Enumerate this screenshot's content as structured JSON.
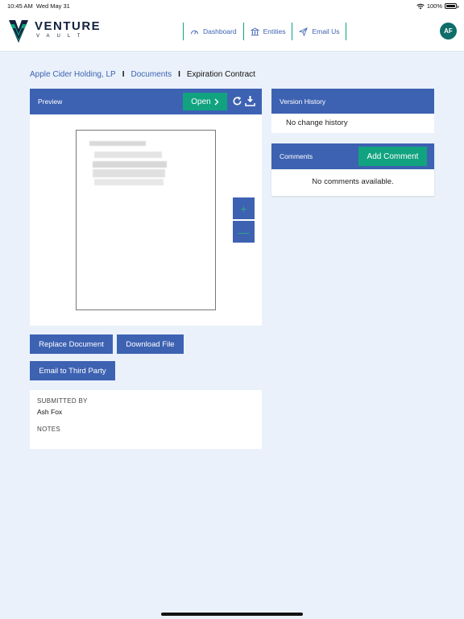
{
  "statusbar": {
    "time": "10:45 AM",
    "date": "Wed May 31",
    "battery": "100%"
  },
  "brand": {
    "name": "VENTURE",
    "sub": "VAULT",
    "colors": {
      "navy": "#13213f",
      "green": "#11a37f",
      "blue": "#3d62b2"
    }
  },
  "nav": {
    "items": [
      {
        "label": "Dashboard",
        "icon": "gauge-icon"
      },
      {
        "label": "Entities",
        "icon": "bank-icon"
      },
      {
        "label": "Email Us",
        "icon": "paper-plane-icon"
      }
    ],
    "avatar": "AF"
  },
  "breadcrumb": {
    "entity": "Apple Cider Holding, LP",
    "section": "Documents",
    "current": "Expiration Contract",
    "separator": "I"
  },
  "preview": {
    "title": "Preview",
    "open_label": "Open",
    "zoom_in": "+",
    "zoom_out": "—"
  },
  "actions": {
    "replace": "Replace Document",
    "download": "Download File",
    "email": "Email to Third Party"
  },
  "details": {
    "submitted_by_label": "SUBMITTED BY",
    "submitted_by": "Ash Fox",
    "notes_label": "NOTES"
  },
  "version_history": {
    "title": "Version History",
    "empty": "No change history"
  },
  "comments": {
    "title": "Comments",
    "add_label": "Add Comment",
    "empty": "No comments available."
  }
}
